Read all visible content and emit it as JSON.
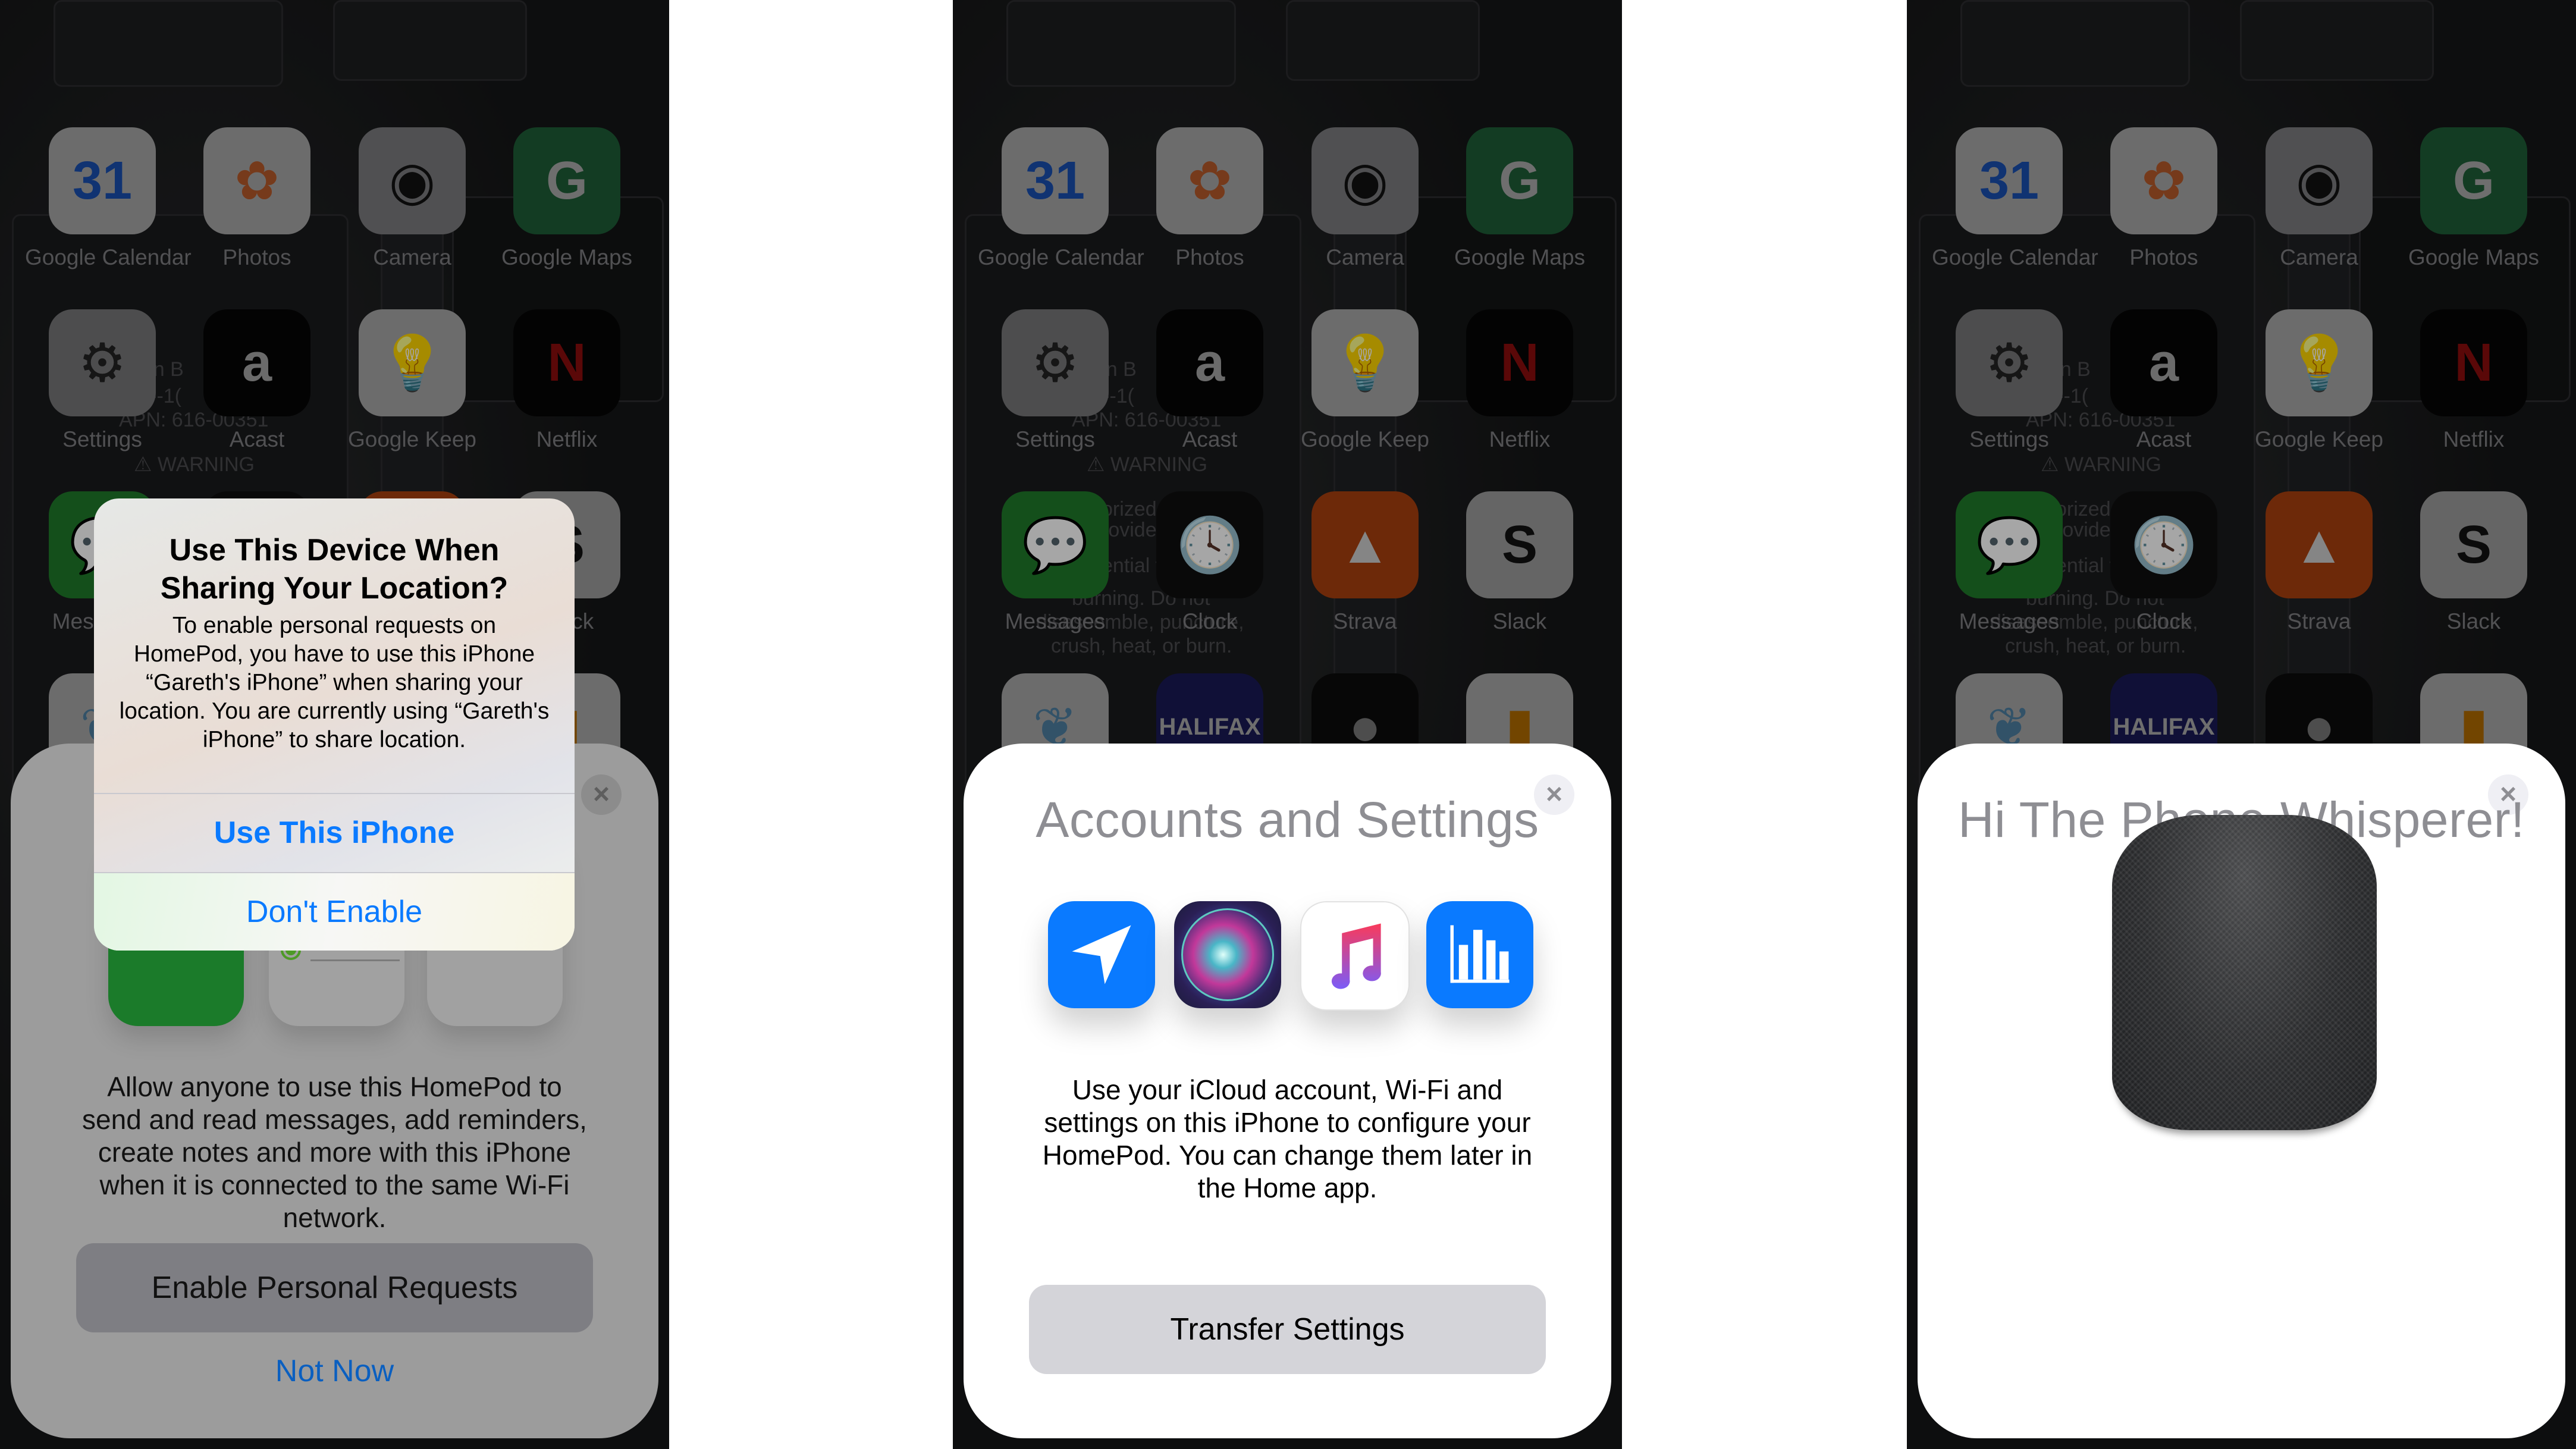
{
  "home_screen": {
    "apps": [
      {
        "label": "Google Calendar",
        "icon": "google-calendar-icon",
        "glyph": "31",
        "bg": "#a7a7a7",
        "fg": "#1a4fb0"
      },
      {
        "label": "Photos",
        "icon": "photos-icon",
        "glyph": "✿",
        "bg": "#a7a7a7",
        "fg": "#b65a2a"
      },
      {
        "label": "Camera",
        "icon": "camera-icon",
        "glyph": "◉",
        "bg": "#7c7c7e",
        "fg": "#111"
      },
      {
        "label": "Google Maps",
        "icon": "google-maps-icon",
        "glyph": "G",
        "bg": "#1e5c36",
        "fg": "#aaa"
      },
      {
        "label": "Settings",
        "icon": "settings-icon",
        "glyph": "⚙",
        "bg": "#777779",
        "fg": "#222"
      },
      {
        "label": "Acast",
        "icon": "acast-icon",
        "glyph": "a",
        "bg": "#060606",
        "fg": "#a5a5a5"
      },
      {
        "label": "Google Keep",
        "icon": "google-keep-icon",
        "glyph": "💡",
        "bg": "#a7a7a7",
        "fg": "#b58a00"
      },
      {
        "label": "Netflix",
        "icon": "netflix-icon",
        "glyph": "N",
        "bg": "#050505",
        "fg": "#8a0d0d"
      },
      {
        "label": "Messages",
        "icon": "messages-icon",
        "glyph": "💬",
        "bg": "#1f7a2a",
        "fg": "#aaa"
      },
      {
        "label": "Clock",
        "icon": "clock-icon",
        "glyph": "🕓",
        "bg": "#0f0f0f",
        "fg": "#bbb"
      },
      {
        "label": "Strava",
        "icon": "strava-icon",
        "glyph": "▲",
        "bg": "#a8400e",
        "fg": "#ccc"
      },
      {
        "label": "Slack",
        "icon": "slack-icon",
        "glyph": "S",
        "bg": "#9c9c9c",
        "fg": "#111"
      }
    ],
    "bottom_row_partial": [
      {
        "label": "",
        "icon": "bank-tree-icon",
        "glyph": "❦",
        "bg": "#a7a7a7",
        "fg": "#4e7ea0"
      },
      {
        "label": "HALIFAX",
        "icon": "halifax-icon",
        "glyph": "HALIFAX",
        "bg": "#1a1a55",
        "fg": "#aaa"
      },
      {
        "label": "",
        "icon": "app-black-icon",
        "glyph": "●",
        "bg": "#0b0b0b",
        "fg": "#777"
      },
      {
        "label": "",
        "icon": "google-analytics-icon",
        "glyph": "▮",
        "bg": "#a7a7a7",
        "fg": "#b06a00"
      }
    ],
    "wallpaper_text": [
      "-ion B",
      "V---1(",
      "APN: 616-00351",
      "⚠ WARNING",
      "orized",
      "rovide",
      "ential f",
      "burning. Do not",
      "disassemble, puncture,",
      "crush, heat, or burn."
    ]
  },
  "panel1": {
    "alert": {
      "title": "Use This Device When Sharing Your Location?",
      "message": "To enable personal requests on HomePod, you have to use this iPhone “Gareth's iPhone” when sharing your location. You are currently using “Gareth's iPhone” to share location.",
      "primary_button": "Use This iPhone",
      "secondary_button": "Don't Enable"
    },
    "sheet": {
      "close_icon": "×",
      "body": "Allow anyone to use this HomePod to send and read messages, add reminders, create notes and more with this iPhone when it is connected to the same Wi-Fi network.",
      "primary_button": "Enable Personal Requests",
      "secondary_button": "Not Now"
    }
  },
  "panel2": {
    "sheet": {
      "close_icon": "×",
      "title": "Accounts and Settings",
      "feature_icons": [
        "location-arrow-icon",
        "siri-icon",
        "apple-music-icon",
        "bar-chart-icon"
      ],
      "body": "Use your iCloud account, Wi-Fi and settings on this iPhone to configure your HomePod. You can change them later in the Home app.",
      "primary_button": "Transfer Settings"
    }
  },
  "panel3": {
    "sheet": {
      "close_icon": "×",
      "title": "Hi The Phone Whisperer!",
      "image": "homepod-speaker"
    }
  },
  "colors": {
    "ios_blue": "#0a7aff",
    "title_grey": "#8e8e93",
    "button_grey": "#d4d4d9",
    "feature_blue": "#0a7aff"
  }
}
